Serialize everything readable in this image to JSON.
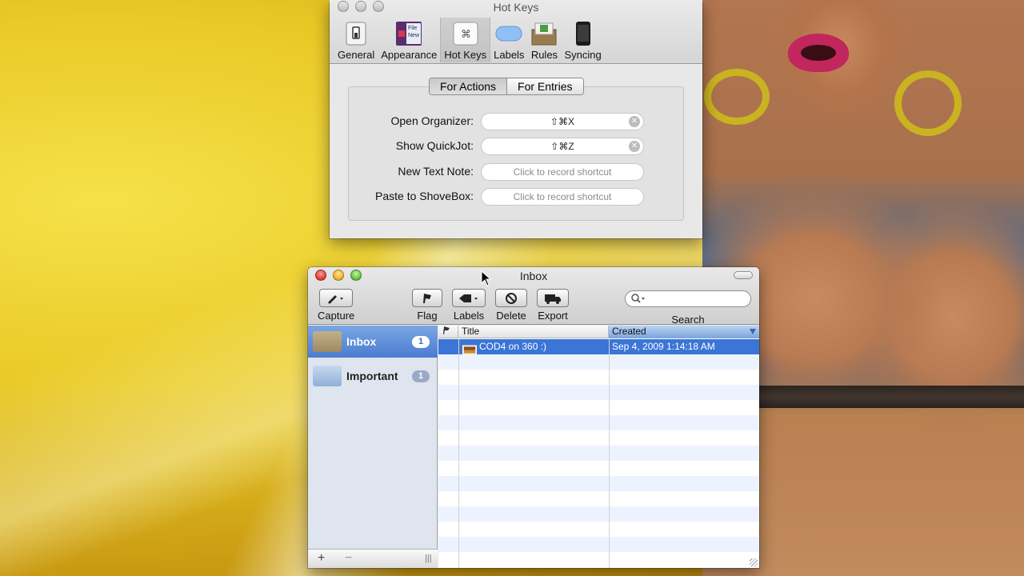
{
  "hotkeys_window": {
    "title": "Hot Keys",
    "toolbar": [
      {
        "label": "General",
        "icon": "switch-icon"
      },
      {
        "label": "Appearance",
        "icon": "appearance-icon"
      },
      {
        "label": "Hot Keys",
        "icon": "keyboard-icon"
      },
      {
        "label": "Labels",
        "icon": "label-pill-icon"
      },
      {
        "label": "Rules",
        "icon": "rules-icon"
      },
      {
        "label": "Syncing",
        "icon": "phone-icon"
      }
    ],
    "selected_tab": "Hot Keys",
    "segments": [
      "For Actions",
      "For Entries"
    ],
    "selected_segment": "For Actions",
    "appearance_icon_text": [
      "File",
      "New"
    ],
    "rows": [
      {
        "label": "Open Organizer:",
        "shortcut": "⇧⌘X",
        "has_clear": true
      },
      {
        "label": "Show QuickJot:",
        "shortcut": "⇧⌘Z",
        "has_clear": true
      },
      {
        "label": "New Text Note:",
        "placeholder": "Click to record shortcut",
        "has_clear": false
      },
      {
        "label": "Paste to ShoveBox:",
        "placeholder": "Click to record shortcut",
        "has_clear": false
      }
    ]
  },
  "inbox_window": {
    "title": "Inbox",
    "toolbar": {
      "capture": "Capture",
      "flag": "Flag",
      "labels": "Labels",
      "delete": "Delete",
      "export": "Export",
      "search": "Search"
    },
    "sources": [
      {
        "name": "Inbox",
        "count": "1",
        "selected": true
      },
      {
        "name": "Important",
        "count": "1",
        "selected": false
      }
    ],
    "columns": {
      "flag": "",
      "title": "Title",
      "created": "Created"
    },
    "sorted_column": "Created",
    "entries": [
      {
        "title": "COD4 on 360 :)",
        "created": "Sep 4, 2009 1:14:18 AM",
        "selected": true
      }
    ],
    "bottom_bar": {
      "add": "+",
      "remove": "−",
      "grip": "|||"
    }
  },
  "colors": {
    "selection_blue": "#3b75d6",
    "source_list_bg": "#dfe5ee",
    "wallpaper_yellow": "#e9c926"
  }
}
